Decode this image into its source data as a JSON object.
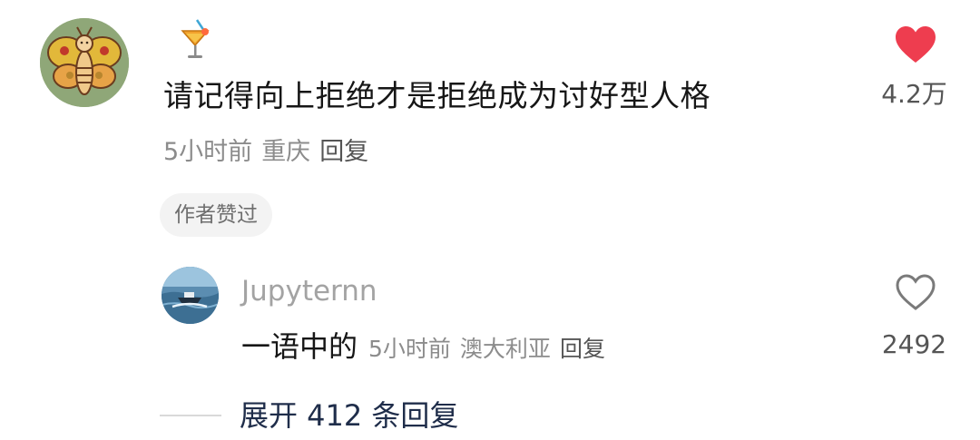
{
  "comment": {
    "text": "请记得向上拒绝才是拒绝成为讨好型人格",
    "time": "5小时前",
    "location": "重庆",
    "reply_label": "回复",
    "author_liked_badge": "作者赞过",
    "like_count": "4.2万",
    "liked": true,
    "like_color": "#ee3d4f",
    "emoji": "tropical-drink-emoji"
  },
  "reply": {
    "username": "Jupyternn",
    "text": "一语中的",
    "time": "5小时前",
    "location": "澳大利亚",
    "reply_label": "回复",
    "like_count": "2492",
    "liked": false
  },
  "expand": {
    "label": "展开 412 条回复"
  }
}
